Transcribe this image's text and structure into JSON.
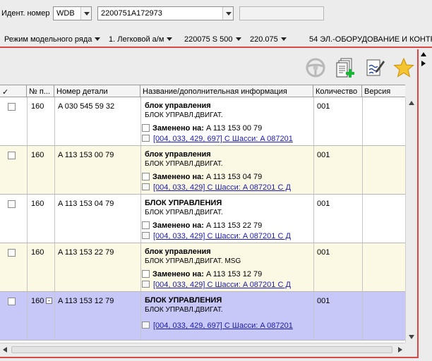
{
  "ident": {
    "label": "Идент. номер",
    "prefix": "WDB",
    "vin": "2200751A172973",
    "extra_value": ""
  },
  "path": {
    "items": [
      "Режим модельного ряда",
      "1. Легковой а/м",
      "220075 S 500",
      "220.075",
      "54 ЭЛ.-ОБОРУДОВАНИЕ И КОНТРО..."
    ]
  },
  "toolbar": {
    "icons": [
      "steering-wheel-icon",
      "add-to-list-icon",
      "edit-note-icon",
      "star-favorite-icon"
    ]
  },
  "columns": {
    "check": "✓",
    "pos": "№ п...",
    "part": "Номер детали",
    "name": "Название/дополнительная информация",
    "qty": "Количество",
    "version": "Версия"
  },
  "rows": [
    {
      "pos": "160",
      "part": "A 030 545 59 32",
      "name": "блок управления",
      "desc": "БЛОК УПРАВЛ.ДВИГАТ.",
      "replaced_label": "Заменено на:",
      "replaced_value": "A 113 153 00 79",
      "doc_link": "[004, 033, 429, 697] С Шасси: A 087201",
      "qty": "001",
      "style": "white"
    },
    {
      "pos": "160",
      "part": "A 113 153 00 79",
      "name": "блок управления",
      "desc": "БЛОК УПРАВЛ.ДВИГАТ.",
      "replaced_label": "Заменено на:",
      "replaced_value": "A 113 153 04 79",
      "doc_link": "[004, 033, 429] С Шасси: A 087201 С Д",
      "qty": "001",
      "style": "cream"
    },
    {
      "pos": "160",
      "part": "A 113 153 04 79",
      "name": "БЛОК УПРАВЛЕНИЯ",
      "desc": "БЛОК УПРАВЛ.ДВИГАТ.",
      "replaced_label": "Заменено на:",
      "replaced_value": "A 113 153 22 79",
      "doc_link": "[004, 033, 429] С Шасси: A 087201 С Д",
      "qty": "001",
      "style": "white"
    },
    {
      "pos": "160",
      "part": "A 113 153 22 79",
      "name": "блок управления",
      "desc": "БЛОК УПРАВЛ.ДВИГАТ. MSG",
      "replaced_label": "Заменено на:",
      "replaced_value": "A 113 153 12 79",
      "doc_link": "[004, 033, 429] С Шасси: A 087201 С Д",
      "qty": "001",
      "style": "cream"
    },
    {
      "pos": "160",
      "minus": "-",
      "part": "A 113 153 12 79",
      "name": "БЛОК УПРАВЛЕНИЯ",
      "desc": "БЛОК УПРАВЛ.ДВИГАТ.",
      "doc_link": "[004, 033, 429, 697] С Шасси: A 087201",
      "qty": "001",
      "style": "selected"
    }
  ]
}
